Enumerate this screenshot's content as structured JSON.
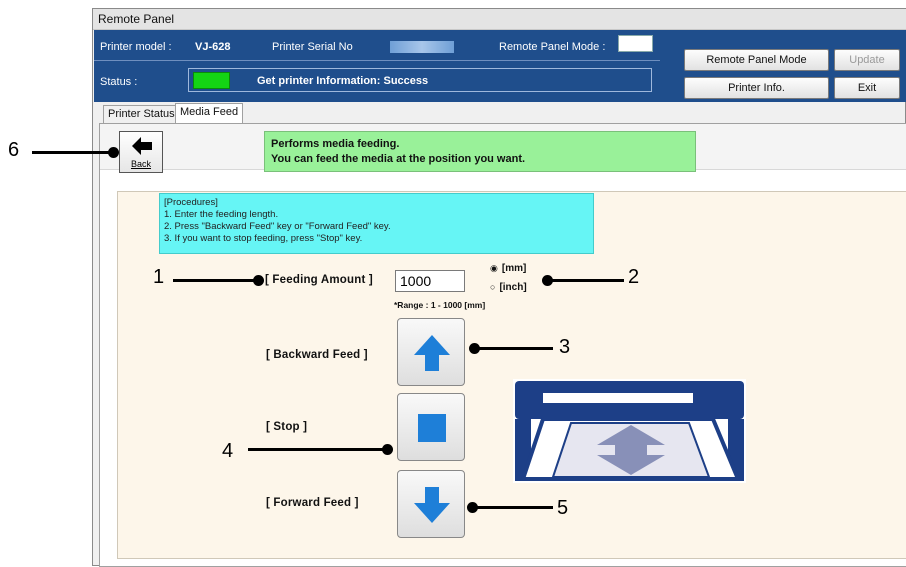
{
  "window": {
    "title": "Remote Panel"
  },
  "header": {
    "printer_model_label": "Printer model :",
    "printer_model_value": "VJ-628",
    "serial_label": "Printer Serial No",
    "remote_mode_label": "Remote Panel Mode :",
    "status_label": "Status :",
    "status_text": "Get printer Information: Success",
    "status_color": "#14d414"
  },
  "buttons": {
    "remote_panel_mode": "Remote Panel Mode",
    "update": "Update",
    "printer_info": "Printer Info.",
    "exit": "Exit"
  },
  "tabs": [
    {
      "label": "Printer Status",
      "active": false
    },
    {
      "label": "Media Feed",
      "active": true
    }
  ],
  "back_button": {
    "label": "Back",
    "icon": "arrow-left-icon"
  },
  "info": {
    "line1": "Performs media feeding.",
    "line2": "You can feed the media at the position you want."
  },
  "procedures": [
    "[Procedures]",
    "1. Enter the feeding length.",
    "2. Press \"Backward Feed\" key or \"Forward Feed\" key.",
    "3. If you want to stop feeding, press \"Stop\" key."
  ],
  "form": {
    "feeding_amount_label": "[ Feeding Amount ]",
    "feeding_amount_value": "1000",
    "unit_mm": "[mm]",
    "unit_inch": "[inch]",
    "selected_unit": "mm",
    "range_note": "*Range : 1 - 1000 [mm]",
    "backward_label": "[ Backward Feed ]",
    "stop_label": "[ Stop ]",
    "forward_label": "[ Forward Feed ]"
  },
  "callouts": [
    "1",
    "2",
    "3",
    "4",
    "5",
    "6"
  ],
  "colors": {
    "header_bg": "#1f4e8c",
    "info_bg": "#99f199",
    "procedures_bg": "#66f5f5",
    "content_bg": "#fdf6ea",
    "feed_blue": "#1e7fd8",
    "printer_navy": "#1d3f87"
  }
}
